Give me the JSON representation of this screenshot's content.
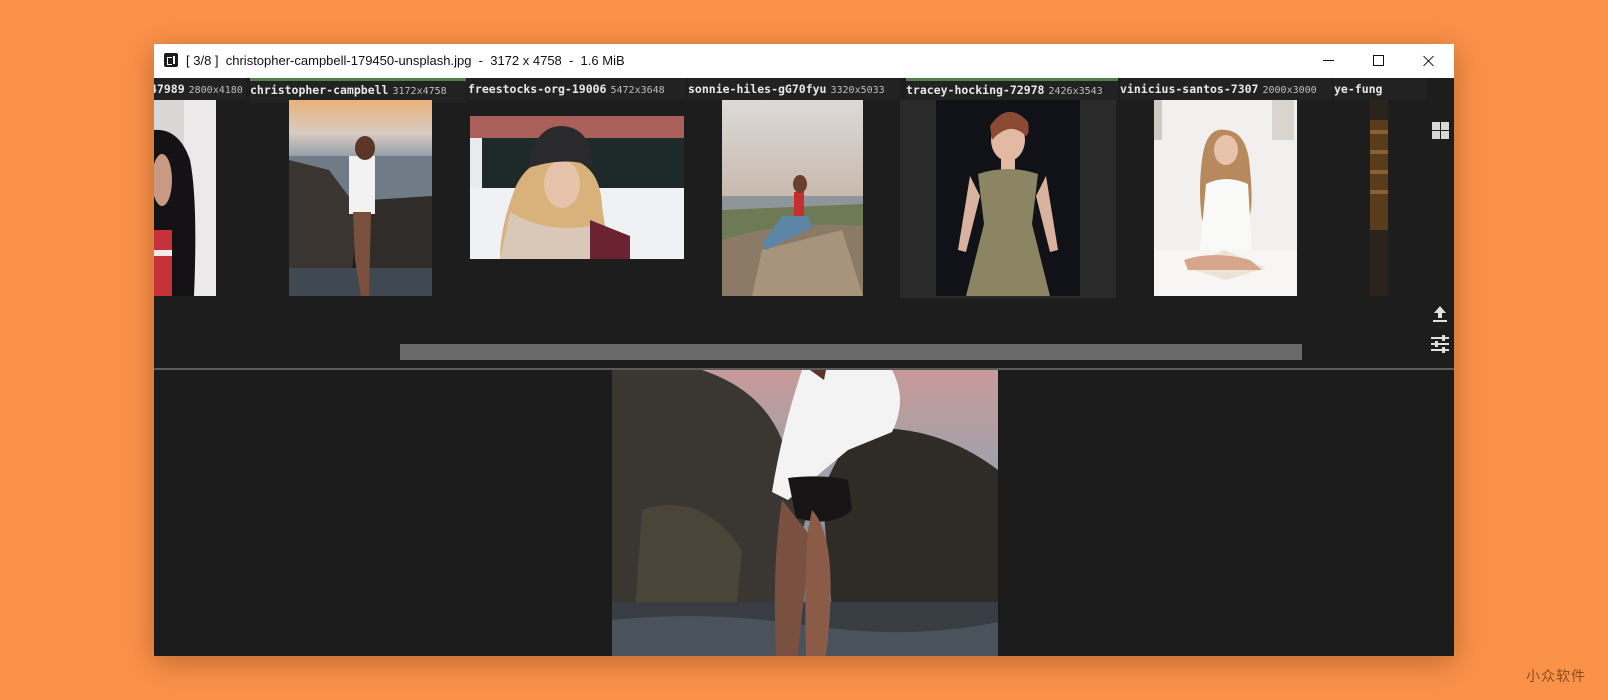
{
  "window": {
    "title": "[ 3/8 ]  christopher-campbell-179450-unsplash.jpg  -  3172 x 4758  -  1.6 MiB"
  },
  "thumbnails": [
    {
      "name": "47989",
      "dims": "2800x4180"
    },
    {
      "name": "christopher-campbell",
      "dims": "3172x4758",
      "active": true
    },
    {
      "name": "freestocks-org-19006",
      "dims": "5472x3648"
    },
    {
      "name": "sonnie-hiles-gG70fyu",
      "dims": "3320x5033"
    },
    {
      "name": "tracey-hocking-72978",
      "dims": "2426x3543",
      "active": true
    },
    {
      "name": "vinicius-santos-7307",
      "dims": "2000x3000"
    },
    {
      "name": "ye-fung",
      "dims": ""
    }
  ],
  "side_toolbar": {
    "icons": [
      "grid-icon",
      "upload-icon",
      "sliders-icon"
    ]
  },
  "colors": {
    "desktop": "#fb924a",
    "window_bg": "#1b1b1b",
    "active_tab_accent": "#4f7f4a",
    "scrollbar": "#6a6a6a"
  },
  "watermark": "小众软件"
}
